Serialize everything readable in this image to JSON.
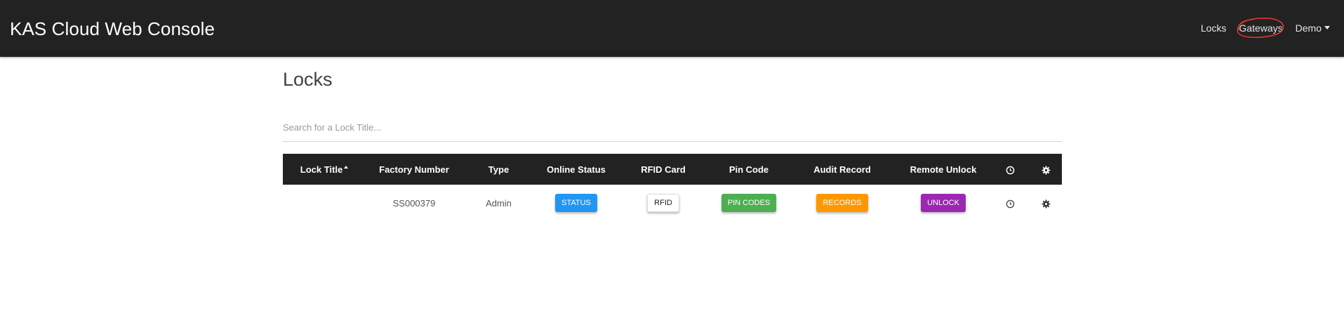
{
  "navbar": {
    "brand": "KAS Cloud Web Console",
    "links": [
      "Locks",
      "Gateways"
    ],
    "user_menu": "Demo"
  },
  "page": {
    "title": "Locks"
  },
  "search": {
    "placeholder": "Search for a Lock Title..."
  },
  "table": {
    "columns": [
      "Lock Title",
      "Factory Number",
      "Type",
      "Online Status",
      "RFID Card",
      "Pin Code",
      "Audit Record",
      "Remote Unlock"
    ],
    "rows": [
      {
        "lock_title": "",
        "factory_number": "SS000379",
        "type": "Admin",
        "status_btn": "STATUS",
        "rfid_btn": "RFID",
        "pin_btn": "PIN CODES",
        "records_btn": "RECORDS",
        "unlock_btn": "UNLOCK"
      }
    ]
  },
  "icons": {
    "history": "clock-icon",
    "settings": "gear-icon"
  },
  "colors": {
    "navbar": "#222222",
    "status": "#2196f3",
    "pin": "#4caf50",
    "records": "#ff9800",
    "unlock": "#9c27b0",
    "annotation": "#e53935"
  }
}
